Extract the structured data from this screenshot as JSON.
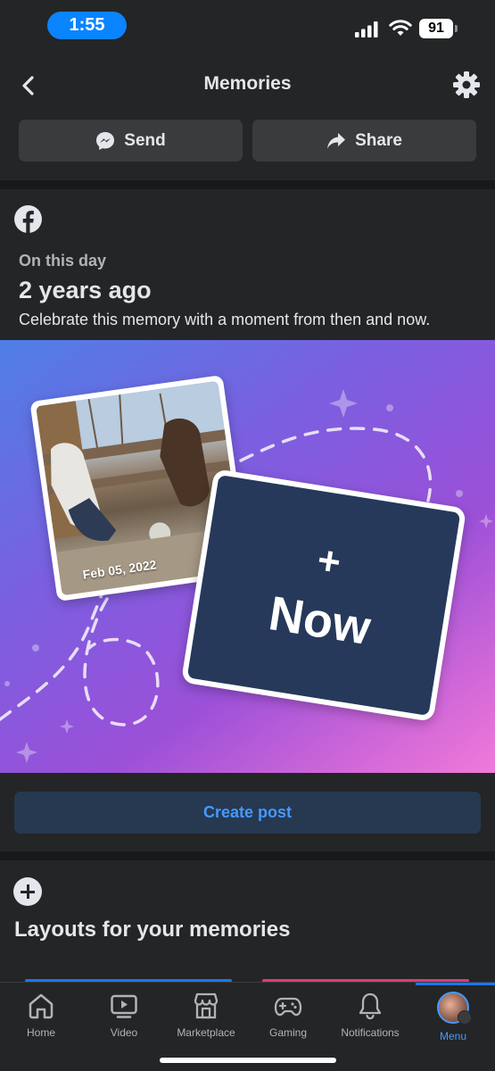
{
  "status_bar": {
    "time": "1:55",
    "battery": "91"
  },
  "header": {
    "title": "Memories",
    "send_label": "Send",
    "share_label": "Share"
  },
  "memory": {
    "eyebrow": "On this day",
    "headline": "2 years ago",
    "description": "Celebrate this memory with a moment from then and now.",
    "photo_date": "Feb 05, 2022",
    "now_plus": "+",
    "now_label": "Now",
    "create_post_label": "Create post"
  },
  "layouts": {
    "title": "Layouts for your memories"
  },
  "tabs": [
    {
      "label": "Home",
      "icon": "home-icon"
    },
    {
      "label": "Video",
      "icon": "video-icon"
    },
    {
      "label": "Marketplace",
      "icon": "marketplace-icon"
    },
    {
      "label": "Gaming",
      "icon": "gaming-icon"
    },
    {
      "label": "Notifications",
      "icon": "bell-icon"
    },
    {
      "label": "Menu",
      "icon": "avatar"
    }
  ],
  "colors": {
    "accent": "#4599ff",
    "background": "#18191a",
    "card": "#242526",
    "button": "#3a3b3c"
  }
}
